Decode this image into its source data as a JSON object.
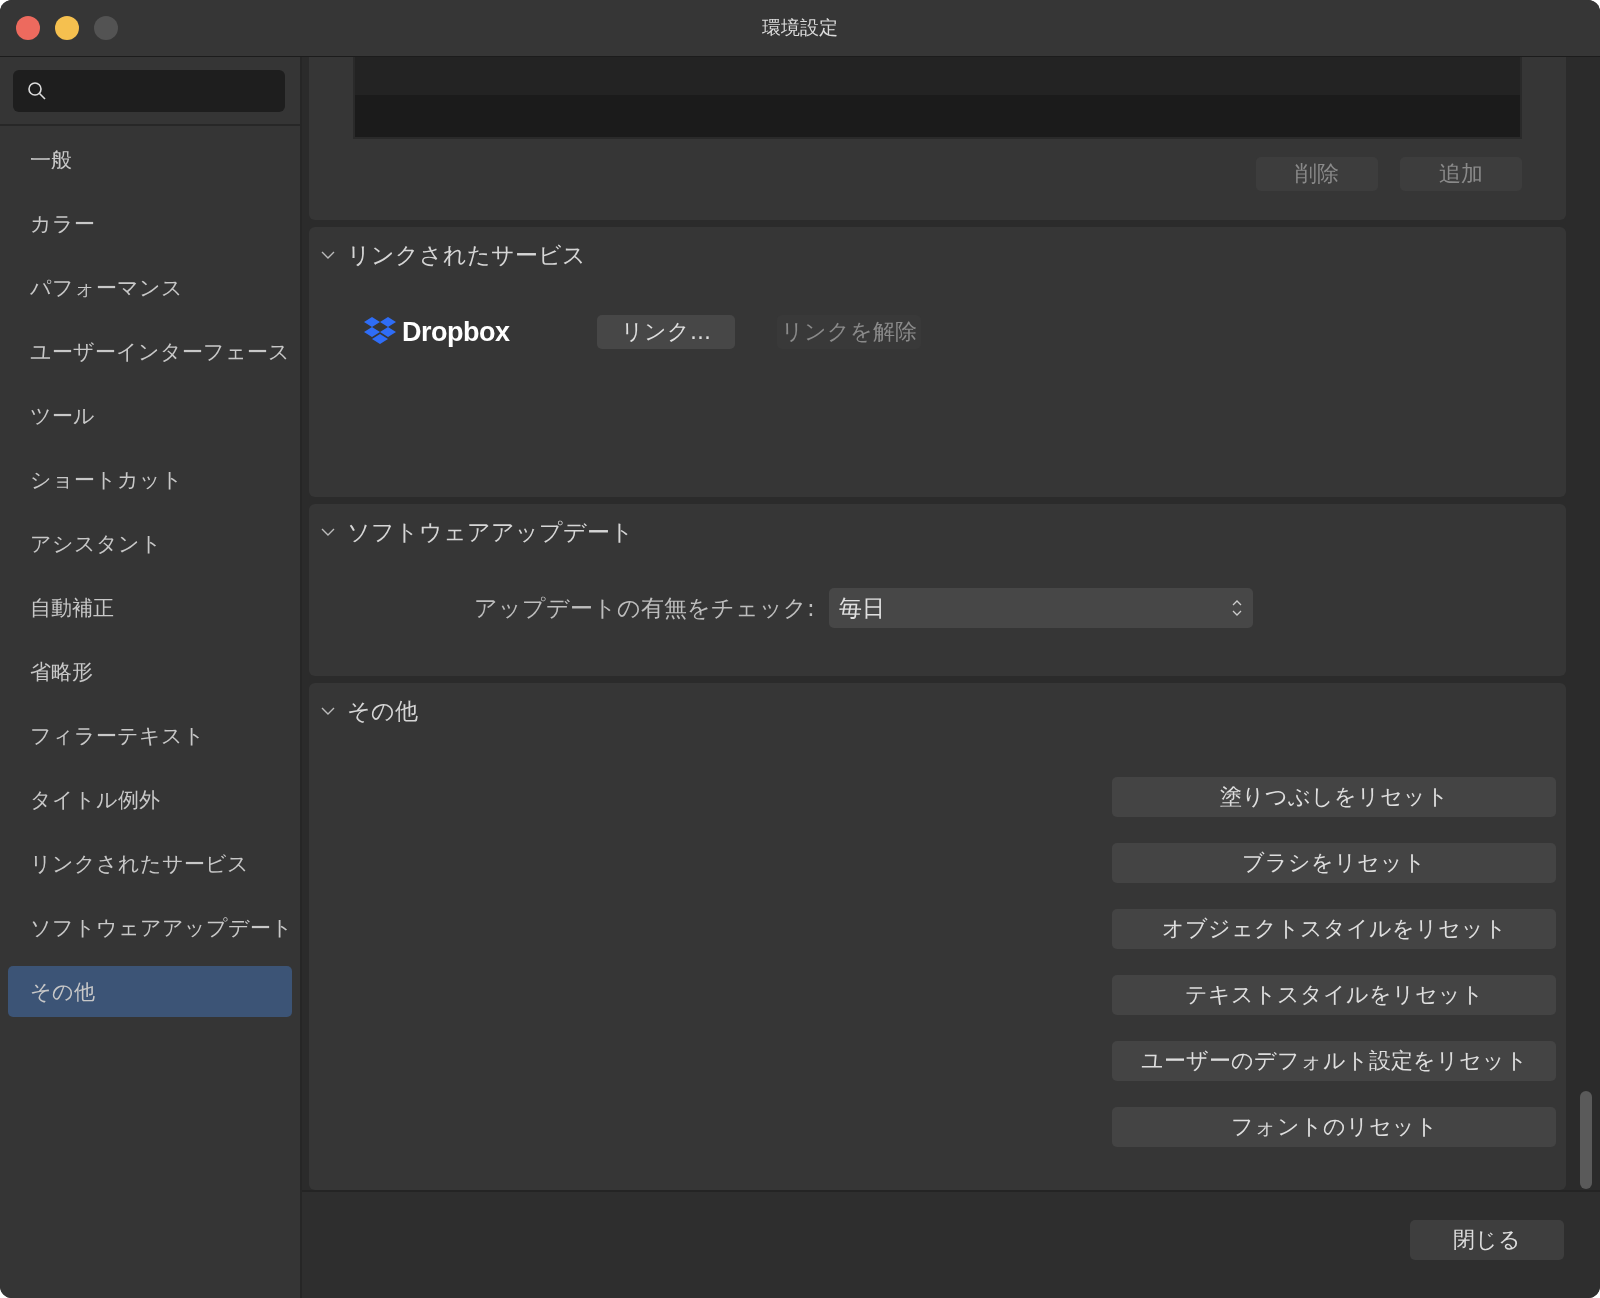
{
  "window": {
    "title": "環境設定"
  },
  "sidebar": {
    "items": [
      {
        "label": "一般",
        "selected": false
      },
      {
        "label": "カラー",
        "selected": false
      },
      {
        "label": "パフォーマンス",
        "selected": false
      },
      {
        "label": "ユーザーインターフェース",
        "selected": false
      },
      {
        "label": "ツール",
        "selected": false
      },
      {
        "label": "ショートカット",
        "selected": false
      },
      {
        "label": "アシスタント",
        "selected": false
      },
      {
        "label": "自動補正",
        "selected": false
      },
      {
        "label": "省略形",
        "selected": false
      },
      {
        "label": "フィラーテキスト",
        "selected": false
      },
      {
        "label": "タイトル例外",
        "selected": false
      },
      {
        "label": "リンクされたサービス",
        "selected": false
      },
      {
        "label": "ソフトウェアアップデート",
        "selected": false
      },
      {
        "label": "その他",
        "selected": true
      }
    ]
  },
  "top_section": {
    "buttons": [
      {
        "label": "削除",
        "disabled": true
      },
      {
        "label": "追加",
        "disabled": true
      }
    ]
  },
  "linked_services": {
    "title": "リンクされたサービス",
    "expanded": true,
    "service": "Dropbox",
    "link_button": {
      "label": "リンク...",
      "disabled": false
    },
    "unlink_button": {
      "label": "リンクを解除",
      "disabled": true
    }
  },
  "software_update": {
    "title": "ソフトウェアアップデート",
    "expanded": true,
    "check_label": "アップデートの有無をチェック:",
    "check_value": "毎日"
  },
  "other": {
    "title": "その他",
    "expanded": true,
    "buttons": [
      "塗りつぶしをリセット",
      "ブラシをリセット",
      "オブジェクトスタイルをリセット",
      "テキストスタイルをリセット",
      "ユーザーのデフォルト設定をリセット",
      "フォントのリセット"
    ]
  },
  "footer": {
    "close_button": "閉じる"
  }
}
